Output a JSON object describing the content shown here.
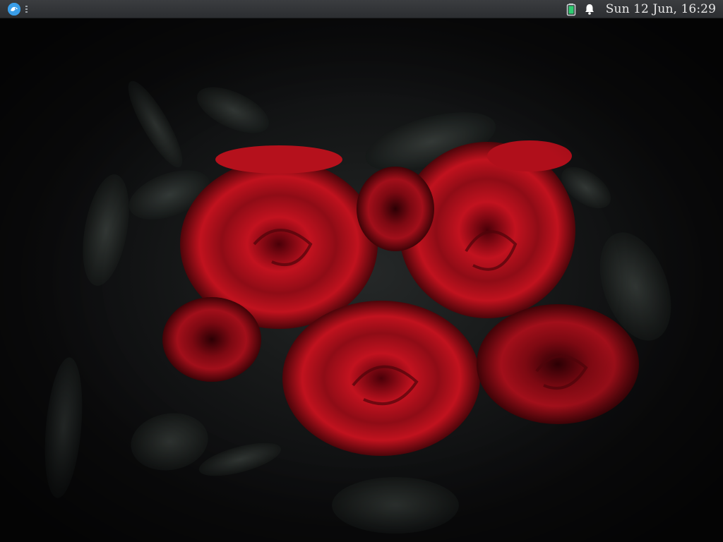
{
  "panel": {
    "launcher_icon": "app-launcher-icon",
    "tray": {
      "battery_icon": "battery-icon",
      "notification_icon": "bell-icon",
      "clock": "Sun 12 Jun, 16:29"
    }
  },
  "desktop": {
    "wallpaper": "red-roses-wallpaper"
  },
  "colors": {
    "panel_bg": "#2f3134",
    "launcher_accent": "#3a9ee8",
    "battery_fill": "#2ecc71",
    "rose_red": "#b3111d"
  }
}
